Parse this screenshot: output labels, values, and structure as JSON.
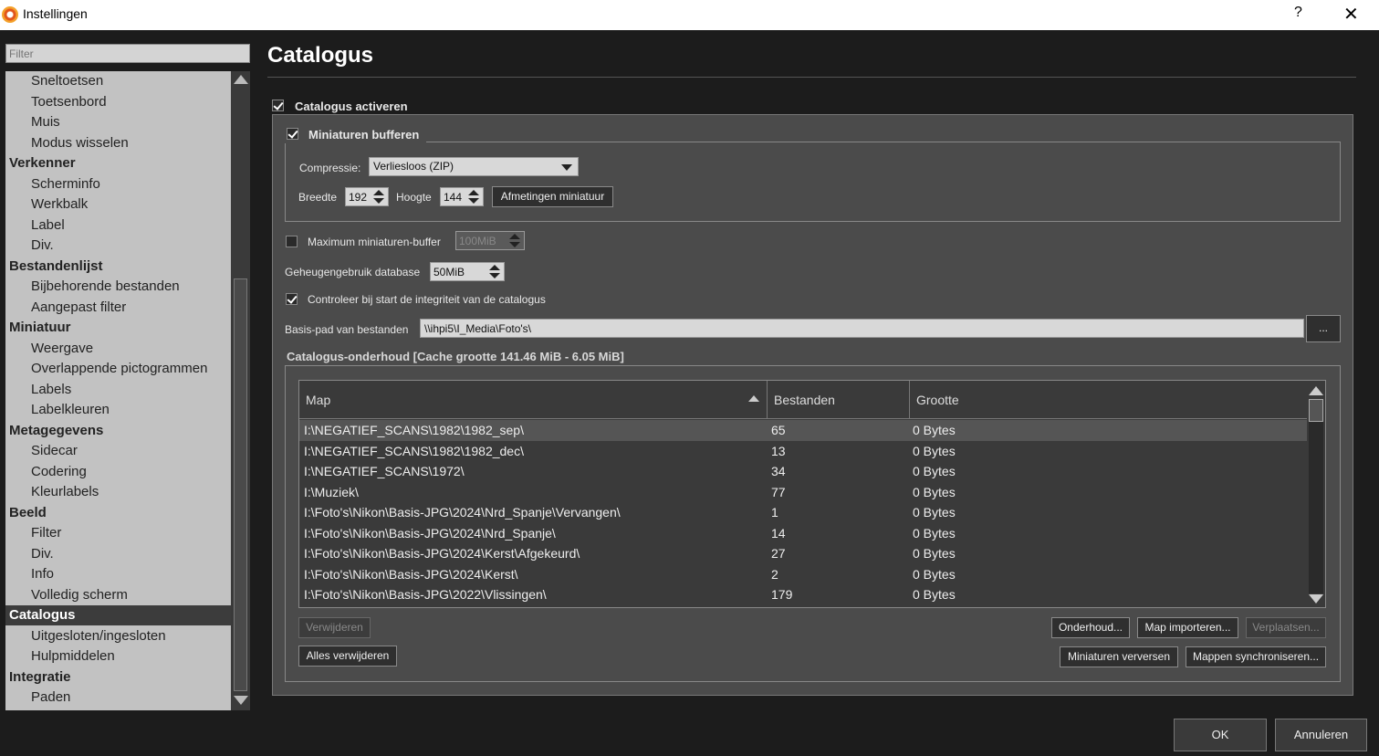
{
  "window": {
    "title": "Instellingen",
    "help": "?",
    "close": "✕"
  },
  "sidebar": {
    "filter_placeholder": "Filter",
    "items": [
      {
        "label": "Sneltoetsen",
        "cat": false
      },
      {
        "label": "Toetsenbord",
        "cat": false
      },
      {
        "label": "Muis",
        "cat": false
      },
      {
        "label": "Modus wisselen",
        "cat": false
      },
      {
        "label": "Verkenner",
        "cat": true
      },
      {
        "label": "Scherminfo",
        "cat": false
      },
      {
        "label": "Werkbalk",
        "cat": false
      },
      {
        "label": "Label",
        "cat": false
      },
      {
        "label": "Div.",
        "cat": false
      },
      {
        "label": "Bestandenlijst",
        "cat": true
      },
      {
        "label": "Bijbehorende bestanden",
        "cat": false
      },
      {
        "label": "Aangepast filter",
        "cat": false
      },
      {
        "label": "Miniatuur",
        "cat": true
      },
      {
        "label": "Weergave",
        "cat": false
      },
      {
        "label": "Overlappende pictogrammen",
        "cat": false
      },
      {
        "label": "Labels",
        "cat": false
      },
      {
        "label": "Labelkleuren",
        "cat": false
      },
      {
        "label": "Metagegevens",
        "cat": true
      },
      {
        "label": "Sidecar",
        "cat": false
      },
      {
        "label": "Codering",
        "cat": false
      },
      {
        "label": "Kleurlabels",
        "cat": false
      },
      {
        "label": "Beeld",
        "cat": true
      },
      {
        "label": "Filter",
        "cat": false
      },
      {
        "label": "Div.",
        "cat": false
      },
      {
        "label": "Info",
        "cat": false
      },
      {
        "label": "Volledig scherm",
        "cat": false
      },
      {
        "label": "Catalogus",
        "cat": true,
        "selected": true
      },
      {
        "label": "Uitgesloten/ingesloten",
        "cat": false
      },
      {
        "label": "Hulpmiddelen",
        "cat": false
      },
      {
        "label": "Integratie",
        "cat": true
      },
      {
        "label": "Paden",
        "cat": false
      }
    ]
  },
  "main": {
    "title": "Catalogus",
    "enable_catalog": {
      "label": "Catalogus activeren",
      "checked": true
    },
    "buffer_thumbs": {
      "label": "Miniaturen bufferen",
      "checked": true
    },
    "compression": {
      "label": "Compressie:",
      "value": "Verliesloos (ZIP)"
    },
    "width": {
      "label": "Breedte",
      "value": "192"
    },
    "height": {
      "label": "Hoogte",
      "value": "144"
    },
    "thumb_size_button": "Afmetingen miniatuur",
    "max_buffer": {
      "label": "Maximum miniaturen-buffer",
      "value": "100MiB",
      "checked": false
    },
    "db_memory": {
      "label": "Geheugengebruik database",
      "value": "50MiB"
    },
    "integrity_check": {
      "label": "Controleer bij start de integriteit van de catalogus",
      "checked": true
    },
    "base_path": {
      "label": "Basis-pad van bestanden",
      "value": "\\\\ihpi5\\I_Media\\Foto's\\",
      "browse": "..."
    },
    "maintenance_title": "Catalogus-onderhoud [Cache grootte 141.46 MiB - 6.05 MiB]",
    "table": {
      "columns": [
        "Map",
        "Bestanden",
        "Grootte"
      ],
      "rows": [
        [
          "I:\\NEGATIEF_SCANS\\1982\\1982_sep\\",
          "65",
          "0 Bytes"
        ],
        [
          "I:\\NEGATIEF_SCANS\\1982\\1982_dec\\",
          "13",
          "0 Bytes"
        ],
        [
          "I:\\NEGATIEF_SCANS\\1972\\",
          "34",
          "0 Bytes"
        ],
        [
          "I:\\Muziek\\",
          "77",
          "0 Bytes"
        ],
        [
          "I:\\Foto's\\Nikon\\Basis-JPG\\2024\\Nrd_Spanje\\Vervangen\\",
          "1",
          "0 Bytes"
        ],
        [
          "I:\\Foto's\\Nikon\\Basis-JPG\\2024\\Nrd_Spanje\\",
          "14",
          "0 Bytes"
        ],
        [
          "I:\\Foto's\\Nikon\\Basis-JPG\\2024\\Kerst\\Afgekeurd\\",
          "27",
          "0 Bytes"
        ],
        [
          "I:\\Foto's\\Nikon\\Basis-JPG\\2024\\Kerst\\",
          "2",
          "0 Bytes"
        ],
        [
          "I:\\Foto's\\Nikon\\Basis-JPG\\2022\\Vlissingen\\",
          "179",
          "0 Bytes"
        ]
      ]
    },
    "buttons": {
      "remove": "Verwijderen",
      "remove_all": "Alles verwijderen",
      "maintenance": "Onderhoud...",
      "import_folder": "Map importeren...",
      "move": "Verplaatsen...",
      "refresh_thumbs": "Miniaturen verversen",
      "sync_folders": "Mappen synchroniseren..."
    }
  },
  "footer": {
    "ok": "OK",
    "cancel": "Annuleren"
  }
}
